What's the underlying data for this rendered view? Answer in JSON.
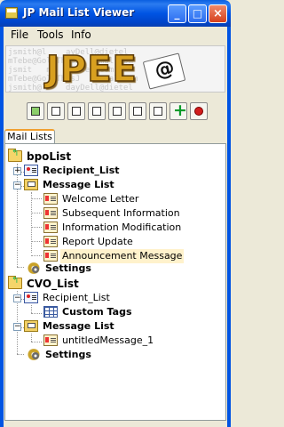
{
  "window": {
    "title": "JP Mail List Viewer",
    "controls": {
      "minimize": "_",
      "maximize": "□",
      "close": "×"
    }
  },
  "menu": [
    "File",
    "Tools",
    "Info"
  ],
  "banner": {
    "logo_text": "JPEE",
    "logo_symbol": "@",
    "background_text": "jsmith@l    ayDell@dietel\nmTebe@GolfThisJ  aSmal.com\njsmit   m      tel com\nmTebe@GolfThisJ  .aSmal.com\njsmith@l    dayDell@dietel\nmTebe@GolfThis  jack@Del.com"
  },
  "toolbar": {
    "icons": [
      "validate-icon",
      "properties-icon",
      "new-list-icon",
      "open-folder-icon",
      "copy-icon",
      "delete-icon",
      "save-icon",
      "add-icon",
      "stop-icon"
    ]
  },
  "tabs": [
    {
      "label": "Mail Lists",
      "active": true
    }
  ],
  "tree": {
    "bpoList": {
      "label": "bpoList",
      "recipient": "Recipient_List",
      "message_list": "Message List",
      "messages": [
        "Welcome Letter",
        "Subsequent Information",
        "Information Modification",
        "Report Update",
        "Announcement Message"
      ],
      "selected_message": "Announcement Message",
      "settings": "Settings"
    },
    "cvoList": {
      "label": "CVO_List",
      "recipient": "Recipient_List",
      "custom_tags": "Custom Tags",
      "message_list": "Message List",
      "messages": [
        "untitledMessage_1"
      ],
      "settings": "Settings"
    }
  },
  "colors": {
    "titlebar": "#0054e3",
    "selection_highlight": "#fff2cc",
    "tab_accent": "#f0a030",
    "logo": "#d8a020"
  }
}
